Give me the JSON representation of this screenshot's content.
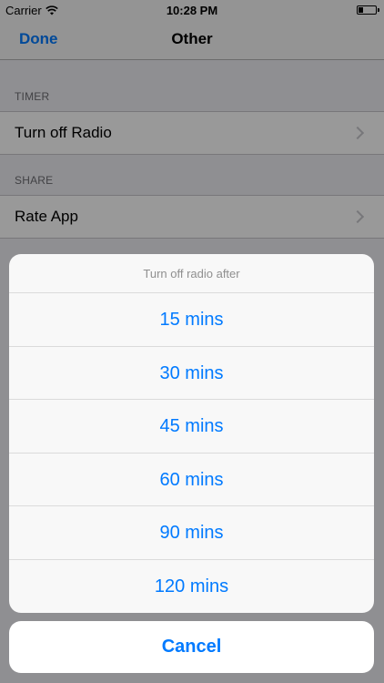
{
  "status_bar": {
    "carrier": "Carrier",
    "time": "10:28 PM"
  },
  "nav": {
    "done_label": "Done",
    "title": "Other"
  },
  "sections": [
    {
      "header": "TIMER",
      "items": [
        {
          "label": "Turn off Radio"
        }
      ]
    },
    {
      "header": "SHARE",
      "items": [
        {
          "label": "Rate App"
        }
      ]
    }
  ],
  "action_sheet": {
    "title": "Turn off radio after",
    "options": [
      {
        "label": "15 mins"
      },
      {
        "label": "30 mins"
      },
      {
        "label": "45 mins"
      },
      {
        "label": "60 mins"
      },
      {
        "label": "90 mins"
      },
      {
        "label": "120 mins"
      }
    ],
    "cancel_label": "Cancel"
  },
  "colors": {
    "accent": "#007aff"
  }
}
